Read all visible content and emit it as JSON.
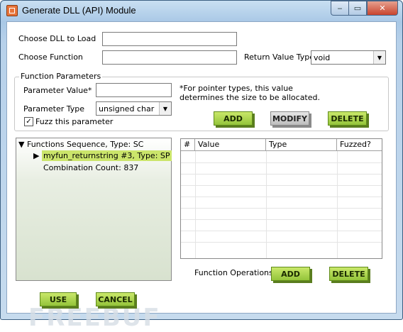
{
  "window": {
    "title": "Generate DLL (API) Module",
    "buttons": {
      "minimize": "‒",
      "maximize": "▭",
      "close": "✕"
    }
  },
  "form": {
    "choose_dll_label": "Choose DLL to Load",
    "choose_dll_value": "",
    "choose_function_label": "Choose Function",
    "choose_function_value": "",
    "return_type_label": "Return Value Type",
    "return_type_value": "void"
  },
  "params": {
    "legend": "Function Parameters",
    "value_label": "Parameter Value*",
    "value": "",
    "note_line1": "*For pointer types, this value",
    "note_line2": "determines the size to be allocated.",
    "type_label": "Parameter Type",
    "type_value": "unsigned char",
    "fuzz_label": "Fuzz this parameter",
    "fuzz_checked": "✓",
    "add": "ADD",
    "modify": "MODIFY",
    "delete": "DELETE"
  },
  "tree": {
    "root": "Functions Sequence, Type: SC",
    "child": "myfun_returnstring #3, Type: SP",
    "combo": "Combination Count: 837"
  },
  "table": {
    "columns": [
      "#",
      "Value",
      "Type",
      "Fuzzed?"
    ]
  },
  "ops": {
    "label": "Function Operations:",
    "add": "ADD",
    "delete": "DELETE"
  },
  "footer": {
    "use": "USE",
    "cancel": "CANCEL"
  },
  "watermark": "FREEBUF",
  "colors": {
    "green_button": "#93c43a",
    "selection": "#cbe56b",
    "title_gradient": "#a9c8e6"
  }
}
